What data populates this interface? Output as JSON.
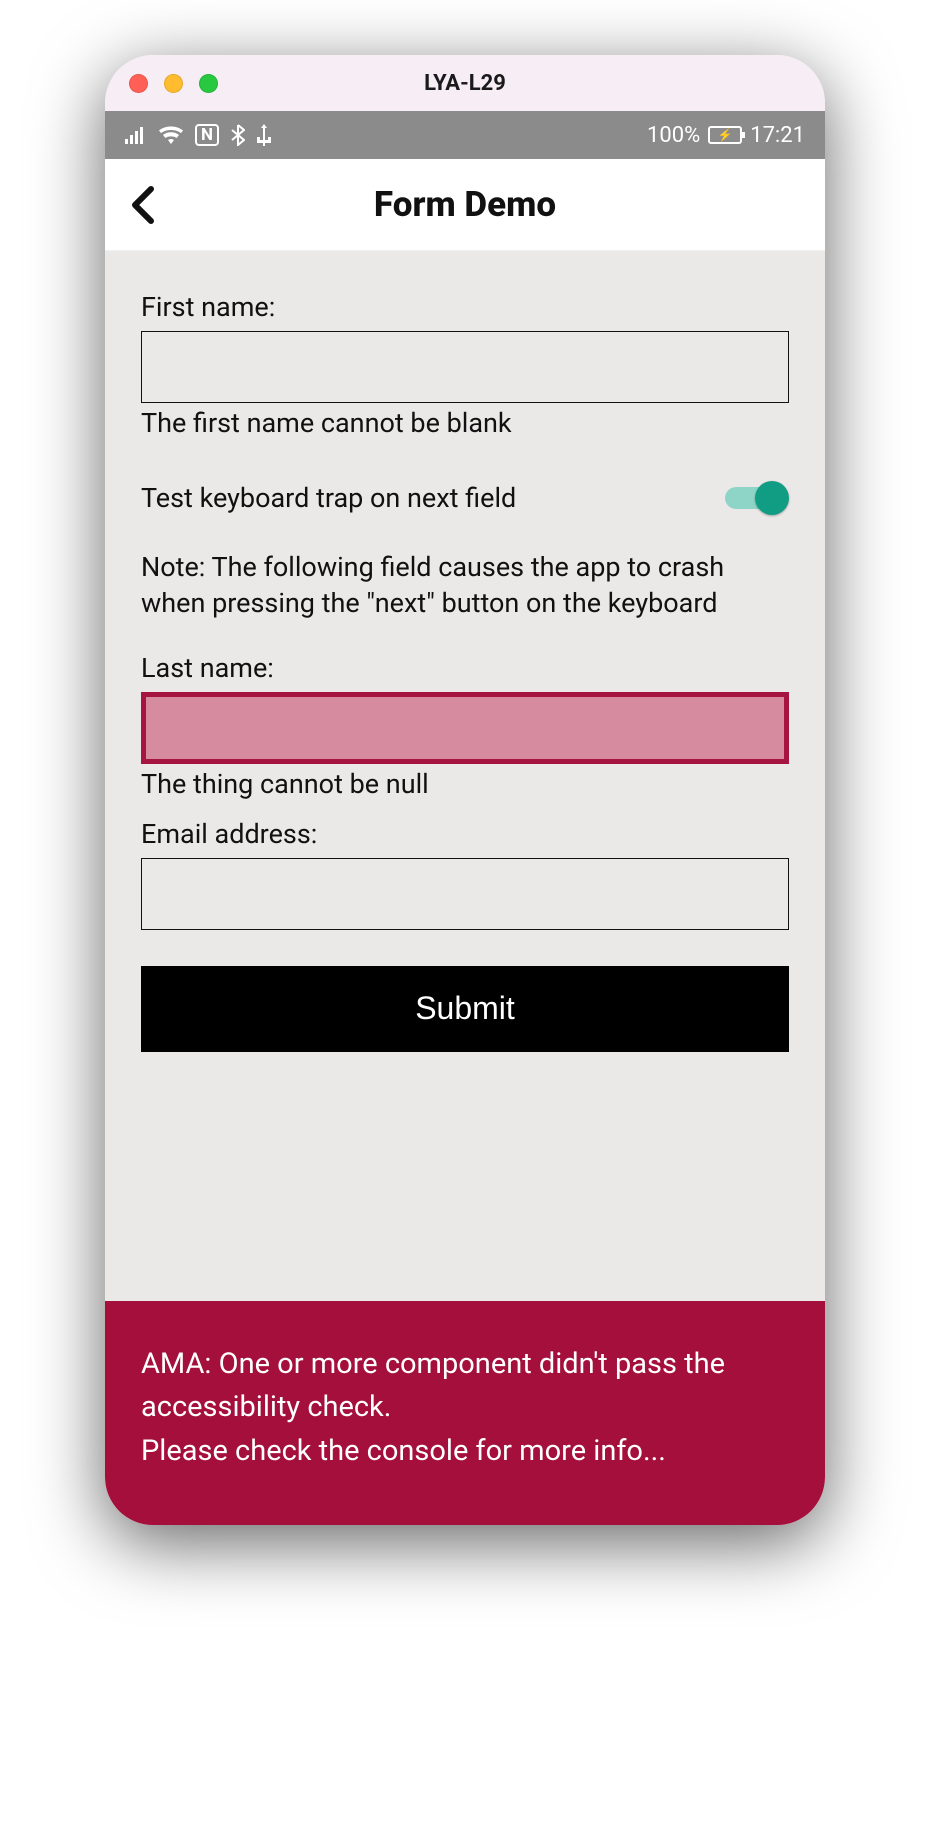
{
  "window": {
    "title": "LYA-L29"
  },
  "statusbar": {
    "battery_text": "100%",
    "time": "17:21"
  },
  "header": {
    "title": "Form Demo"
  },
  "form": {
    "first_name": {
      "label": "First name:",
      "value": "",
      "helper": "The first name cannot be blank"
    },
    "trap_toggle": {
      "label": "Test keyboard trap on next field",
      "on": true
    },
    "note": "Note: The following field causes the app to crash when pressing the \"next\" button on the keyboard",
    "last_name": {
      "label": "Last name:",
      "value": "",
      "helper": "The thing cannot be null"
    },
    "email": {
      "label": "Email address:",
      "value": ""
    },
    "submit_label": "Submit"
  },
  "banner": {
    "line1": "AMA: One or more component didn't pass the accessibility check.",
    "line2": "Please check the console for more info..."
  },
  "colors": {
    "accent": "#119d84",
    "error": "#a40f3b"
  }
}
